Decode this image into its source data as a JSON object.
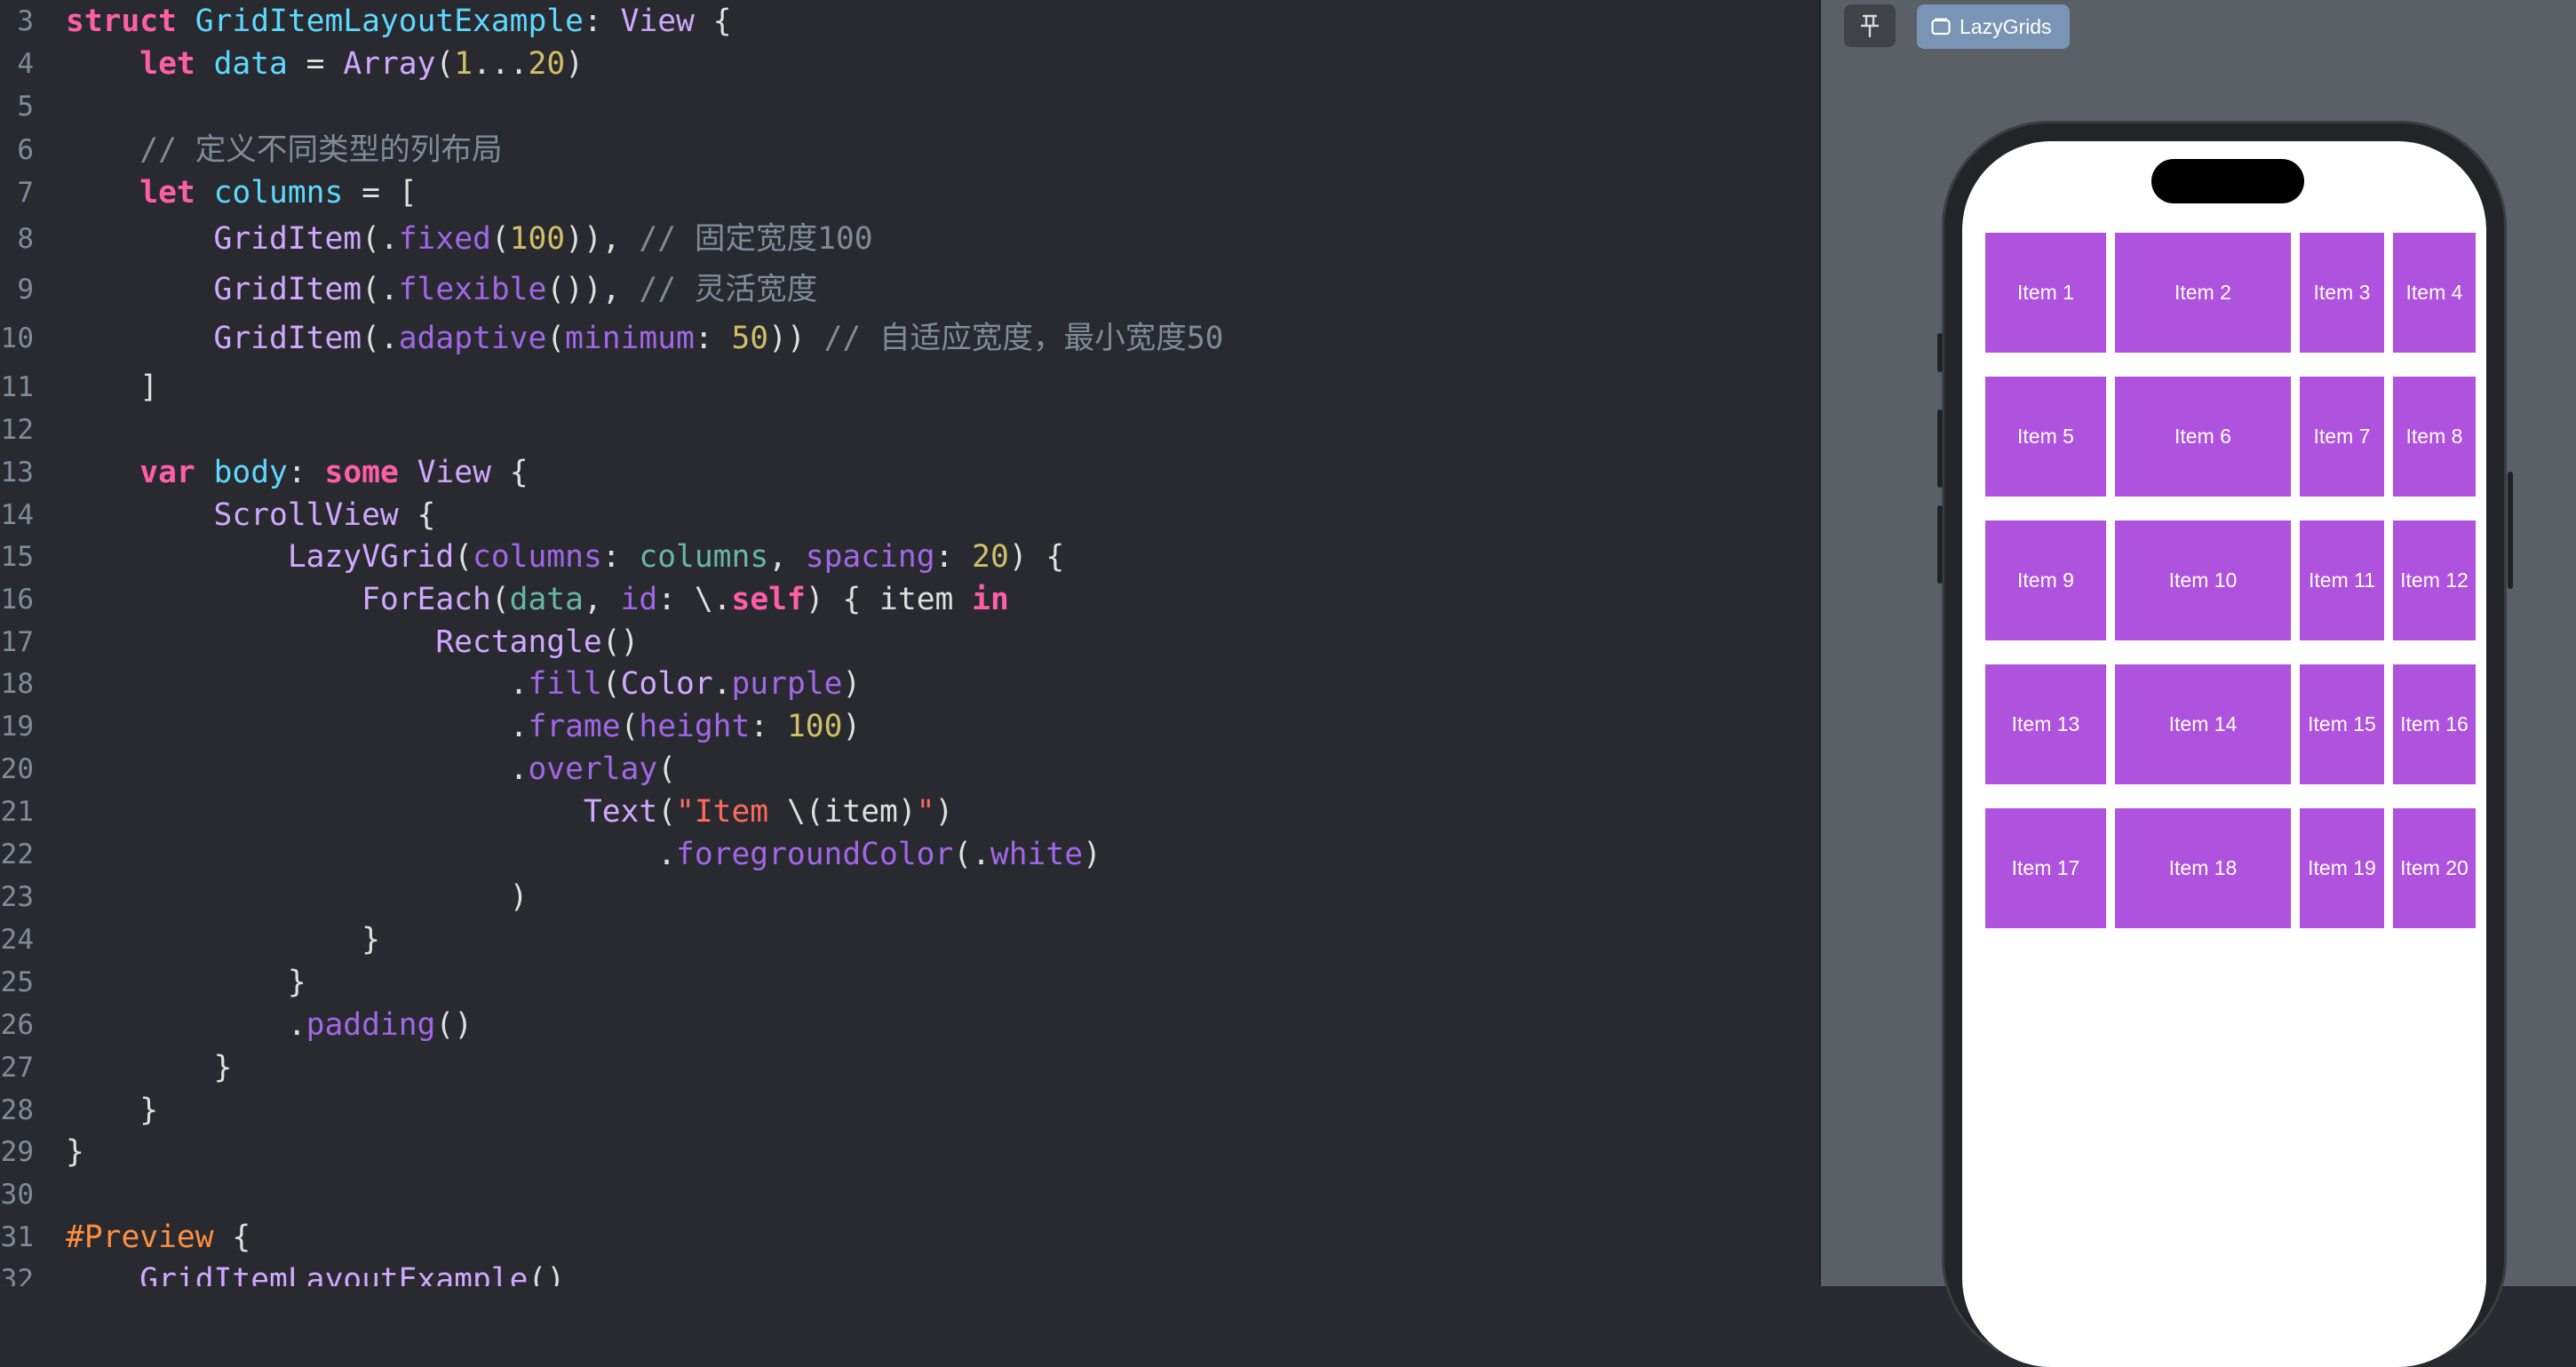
{
  "editor": {
    "lines": [
      {
        "n": "3",
        "tokens": [
          [
            "kw",
            "struct"
          ],
          [
            "tx",
            " "
          ],
          [
            "ty",
            "GridItemLayoutExample"
          ],
          [
            "tx",
            ": "
          ],
          [
            "tp",
            "View"
          ],
          [
            "tx",
            " {"
          ]
        ]
      },
      {
        "n": "4",
        "tokens": [
          [
            "tx",
            "    "
          ],
          [
            "kw",
            "let"
          ],
          [
            "tx",
            " "
          ],
          [
            "ty",
            "data"
          ],
          [
            "tx",
            " = "
          ],
          [
            "tp",
            "Array"
          ],
          [
            "tx",
            "("
          ],
          [
            "num",
            "1"
          ],
          [
            "tx",
            "..."
          ],
          [
            "num",
            "20"
          ],
          [
            "tx",
            ")"
          ]
        ]
      },
      {
        "n": "5",
        "tokens": []
      },
      {
        "n": "6",
        "tokens": [
          [
            "cm",
            "    // 定义不同类型的列布局"
          ]
        ]
      },
      {
        "n": "7",
        "tokens": [
          [
            "tx",
            "    "
          ],
          [
            "kw",
            "let"
          ],
          [
            "tx",
            " "
          ],
          [
            "ty",
            "columns"
          ],
          [
            "tx",
            " = ["
          ]
        ]
      },
      {
        "n": "8",
        "tokens": [
          [
            "tx",
            "        "
          ],
          [
            "tp",
            "GridItem"
          ],
          [
            "tx",
            "(."
          ],
          [
            "fn",
            "fixed"
          ],
          [
            "tx",
            "("
          ],
          [
            "num",
            "100"
          ],
          [
            "tx",
            ")), "
          ],
          [
            "cm",
            "// 固定宽度100"
          ]
        ]
      },
      {
        "n": "9",
        "tokens": [
          [
            "tx",
            "        "
          ],
          [
            "tp",
            "GridItem"
          ],
          [
            "tx",
            "(."
          ],
          [
            "fn",
            "flexible"
          ],
          [
            "tx",
            "()), "
          ],
          [
            "cm",
            "// 灵活宽度"
          ]
        ]
      },
      {
        "n": "10",
        "tokens": [
          [
            "tx",
            "        "
          ],
          [
            "tp",
            "GridItem"
          ],
          [
            "tx",
            "(."
          ],
          [
            "fn",
            "adaptive"
          ],
          [
            "tx",
            "("
          ],
          [
            "fn",
            "minimum"
          ],
          [
            "tx",
            ": "
          ],
          [
            "num",
            "50"
          ],
          [
            "tx",
            ")) "
          ],
          [
            "cm",
            "// 自适应宽度，最小宽度50"
          ]
        ]
      },
      {
        "n": "11",
        "tokens": [
          [
            "tx",
            "    ]"
          ]
        ]
      },
      {
        "n": "12",
        "tokens": []
      },
      {
        "n": "13",
        "tokens": [
          [
            "tx",
            "    "
          ],
          [
            "kw",
            "var"
          ],
          [
            "tx",
            " "
          ],
          [
            "ty",
            "body"
          ],
          [
            "tx",
            ": "
          ],
          [
            "kw",
            "some"
          ],
          [
            "tx",
            " "
          ],
          [
            "tp",
            "View"
          ],
          [
            "tx",
            " {"
          ]
        ]
      },
      {
        "n": "14",
        "tokens": [
          [
            "tx",
            "        "
          ],
          [
            "tp",
            "ScrollView"
          ],
          [
            "tx",
            " {"
          ]
        ]
      },
      {
        "n": "15",
        "tokens": [
          [
            "tx",
            "            "
          ],
          [
            "tp",
            "LazyVGrid"
          ],
          [
            "tx",
            "("
          ],
          [
            "fn",
            "columns"
          ],
          [
            "tx",
            ": "
          ],
          [
            "ot",
            "columns"
          ],
          [
            "tx",
            ", "
          ],
          [
            "fn",
            "spacing"
          ],
          [
            "tx",
            ": "
          ],
          [
            "num",
            "20"
          ],
          [
            "tx",
            ") {"
          ]
        ]
      },
      {
        "n": "16",
        "tokens": [
          [
            "tx",
            "                "
          ],
          [
            "tp",
            "ForEach"
          ],
          [
            "tx",
            "("
          ],
          [
            "ot",
            "data"
          ],
          [
            "tx",
            ", "
          ],
          [
            "fn",
            "id"
          ],
          [
            "tx",
            ": \\."
          ],
          [
            "kw",
            "self"
          ],
          [
            "tx",
            ") { item "
          ],
          [
            "kw",
            "in"
          ]
        ]
      },
      {
        "n": "17",
        "tokens": [
          [
            "tx",
            "                    "
          ],
          [
            "tp",
            "Rectangle"
          ],
          [
            "tx",
            "()"
          ]
        ]
      },
      {
        "n": "18",
        "tokens": [
          [
            "tx",
            "                        ."
          ],
          [
            "fn",
            "fill"
          ],
          [
            "tx",
            "("
          ],
          [
            "tp",
            "Color"
          ],
          [
            "tx",
            "."
          ],
          [
            "fn",
            "purple"
          ],
          [
            "tx",
            ")"
          ]
        ]
      },
      {
        "n": "19",
        "tokens": [
          [
            "tx",
            "                        ."
          ],
          [
            "fn",
            "frame"
          ],
          [
            "tx",
            "("
          ],
          [
            "fn",
            "height"
          ],
          [
            "tx",
            ": "
          ],
          [
            "num",
            "100"
          ],
          [
            "tx",
            ")"
          ]
        ]
      },
      {
        "n": "20",
        "tokens": [
          [
            "tx",
            "                        ."
          ],
          [
            "fn",
            "overlay"
          ],
          [
            "tx",
            "("
          ]
        ]
      },
      {
        "n": "21",
        "tokens": [
          [
            "tx",
            "                            "
          ],
          [
            "tp",
            "Text"
          ],
          [
            "tx",
            "("
          ],
          [
            "str",
            "\"Item "
          ],
          [
            "tx",
            "\\(item)"
          ],
          [
            "str",
            "\""
          ],
          [
            "tx",
            ")"
          ]
        ]
      },
      {
        "n": "22",
        "tokens": [
          [
            "tx",
            "                                ."
          ],
          [
            "fn",
            "foregroundColor"
          ],
          [
            "tx",
            "(."
          ],
          [
            "fn",
            "white"
          ],
          [
            "tx",
            ")"
          ]
        ]
      },
      {
        "n": "23",
        "tokens": [
          [
            "tx",
            "                        )"
          ]
        ]
      },
      {
        "n": "24",
        "tokens": [
          [
            "tx",
            "                }"
          ]
        ]
      },
      {
        "n": "25",
        "tokens": [
          [
            "tx",
            "            }"
          ]
        ]
      },
      {
        "n": "26",
        "tokens": [
          [
            "tx",
            "            ."
          ],
          [
            "fn",
            "padding"
          ],
          [
            "tx",
            "()"
          ]
        ]
      },
      {
        "n": "27",
        "tokens": [
          [
            "tx",
            "        }"
          ]
        ]
      },
      {
        "n": "28",
        "tokens": [
          [
            "tx",
            "    }"
          ]
        ]
      },
      {
        "n": "29",
        "tokens": [
          [
            "tx",
            "}"
          ]
        ]
      },
      {
        "n": "30",
        "tokens": []
      },
      {
        "n": "31",
        "tokens": [
          [
            "mac",
            "#Preview"
          ],
          [
            "tx",
            " {"
          ]
        ]
      },
      {
        "n": "32",
        "tokens": [
          [
            "tx",
            "    "
          ],
          [
            "tp",
            "GridItemLayoutExample"
          ],
          [
            "tx",
            "()"
          ]
        ]
      }
    ]
  },
  "preview": {
    "pin_icon": "pin-icon",
    "tab_icon": "window-icon",
    "tab_label": "LazyGrids",
    "items": [
      "Item 1",
      "Item 2",
      "Item 3",
      "Item 4",
      "Item 5",
      "Item 6",
      "Item 7",
      "Item 8",
      "Item 9",
      "Item 10",
      "Item 11",
      "Item 12",
      "Item 13",
      "Item 14",
      "Item 15",
      "Item 16",
      "Item 17",
      "Item 18",
      "Item 19",
      "Item 20"
    ]
  },
  "colors": {
    "editor_bg": "#292a30",
    "canvas_bg": "#5b5f66",
    "tab_bg": "#7a94b6",
    "grid_item": "#af52de"
  }
}
